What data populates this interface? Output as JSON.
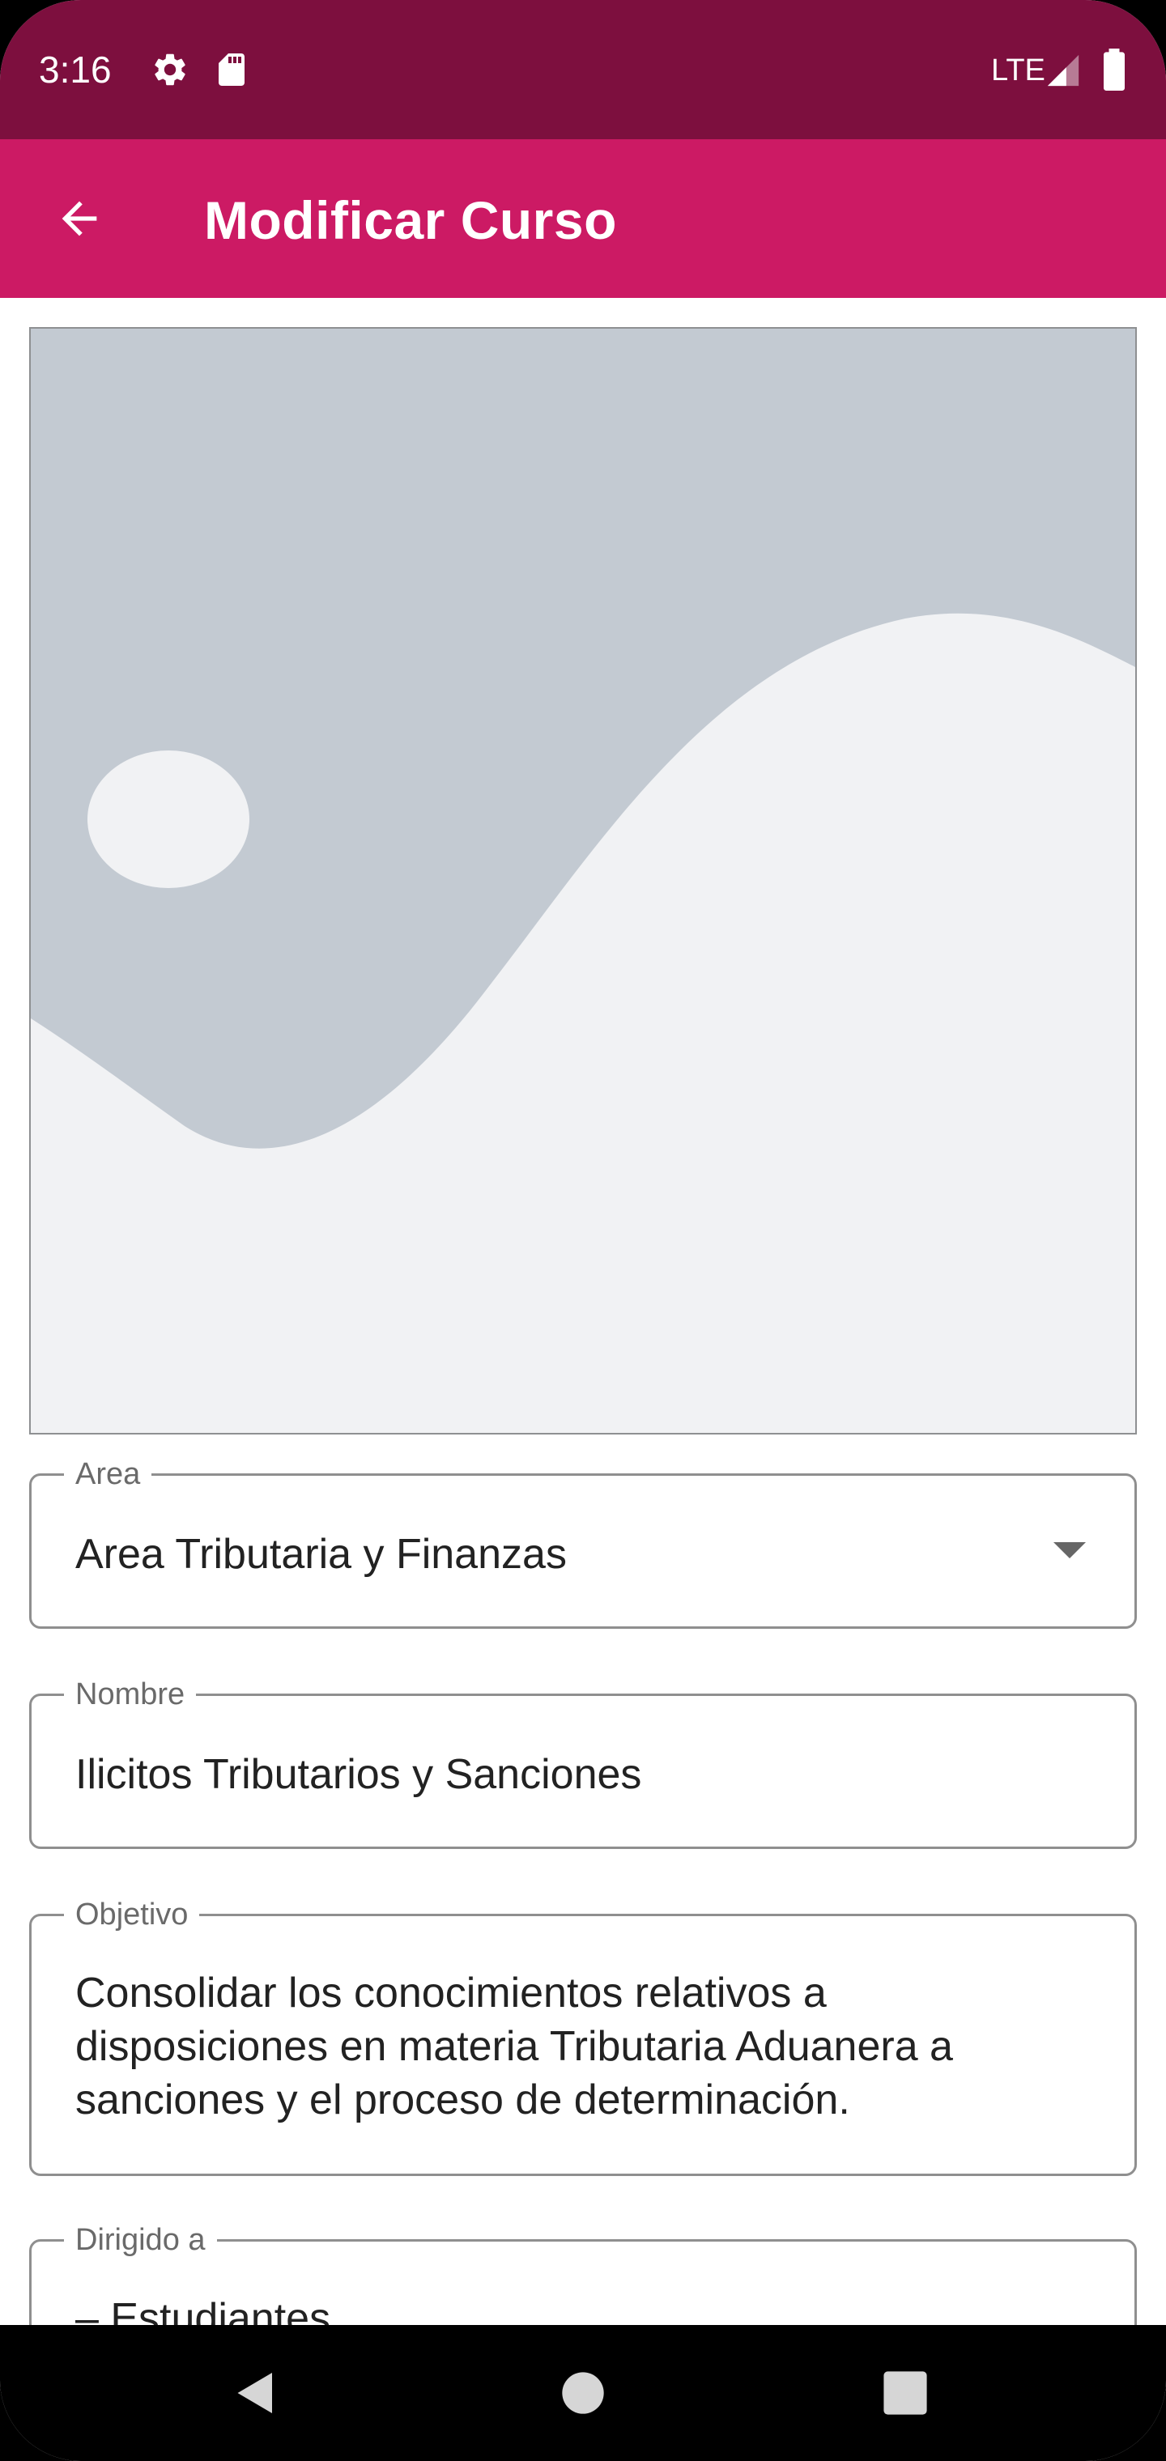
{
  "status_bar": {
    "time": "3:16",
    "network": "LTE",
    "icons": [
      "settings-icon",
      "sd-card-icon",
      "signal-icon",
      "battery-icon"
    ]
  },
  "app_bar": {
    "title": "Modificar Curso",
    "back_icon": "arrow-back-icon",
    "color": "#cc1a64",
    "status_color": "#7d0f3e"
  },
  "image": {
    "icon": "image-placeholder-icon"
  },
  "form": {
    "area": {
      "label": "Area",
      "value": "Area Tributaria y Finanzas"
    },
    "nombre": {
      "label": "Nombre",
      "value": "Ilicitos Tributarios y Sanciones"
    },
    "objetivo": {
      "label": "Objetivo",
      "lines": [
        "Consolidar los conocimientos relativos a",
        "disposiciones en materia Tributaria Aduanera a",
        "sanciones y el proceso de determinación."
      ]
    },
    "dirigido": {
      "label": "Dirigido a",
      "value": "– Estudiantes"
    }
  },
  "nav_bar": {
    "icons": [
      "back-triangle-icon",
      "home-circle-icon",
      "recents-square-icon"
    ]
  }
}
